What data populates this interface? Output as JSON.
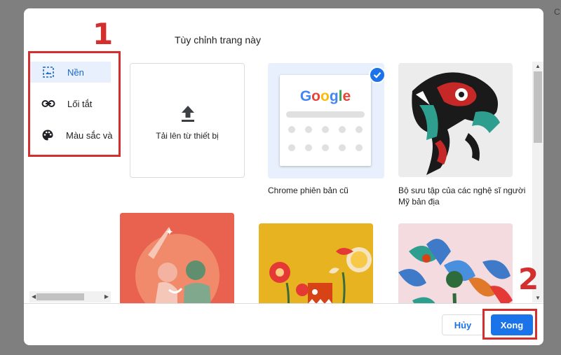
{
  "dialog": {
    "title": "Tùy chỉnh trang này",
    "corner_char": "C"
  },
  "sidebar": {
    "items": [
      {
        "label": "Nền",
        "icon": "image-icon",
        "active": true
      },
      {
        "label": "Lối tắt",
        "icon": "link-icon",
        "active": false
      },
      {
        "label": "Màu sắc và",
        "icon": "palette-icon",
        "active": false
      }
    ]
  },
  "tiles": {
    "upload_label": "Tải lên từ thiết bị",
    "classic": {
      "label": "Chrome phiên bản cũ",
      "logo_text": "Google",
      "selected": true
    },
    "collection": {
      "label": "Bộ sưu tập của các nghệ sĩ người Mỹ bản địa"
    }
  },
  "annotations": {
    "step1": "1",
    "step2": "2"
  },
  "footer": {
    "cancel_label": "Hủy",
    "done_label": "Xong"
  },
  "colors": {
    "accent": "#1a73e8",
    "annotation_red": "#d32f2f",
    "active_bg": "#e8f0fe"
  }
}
